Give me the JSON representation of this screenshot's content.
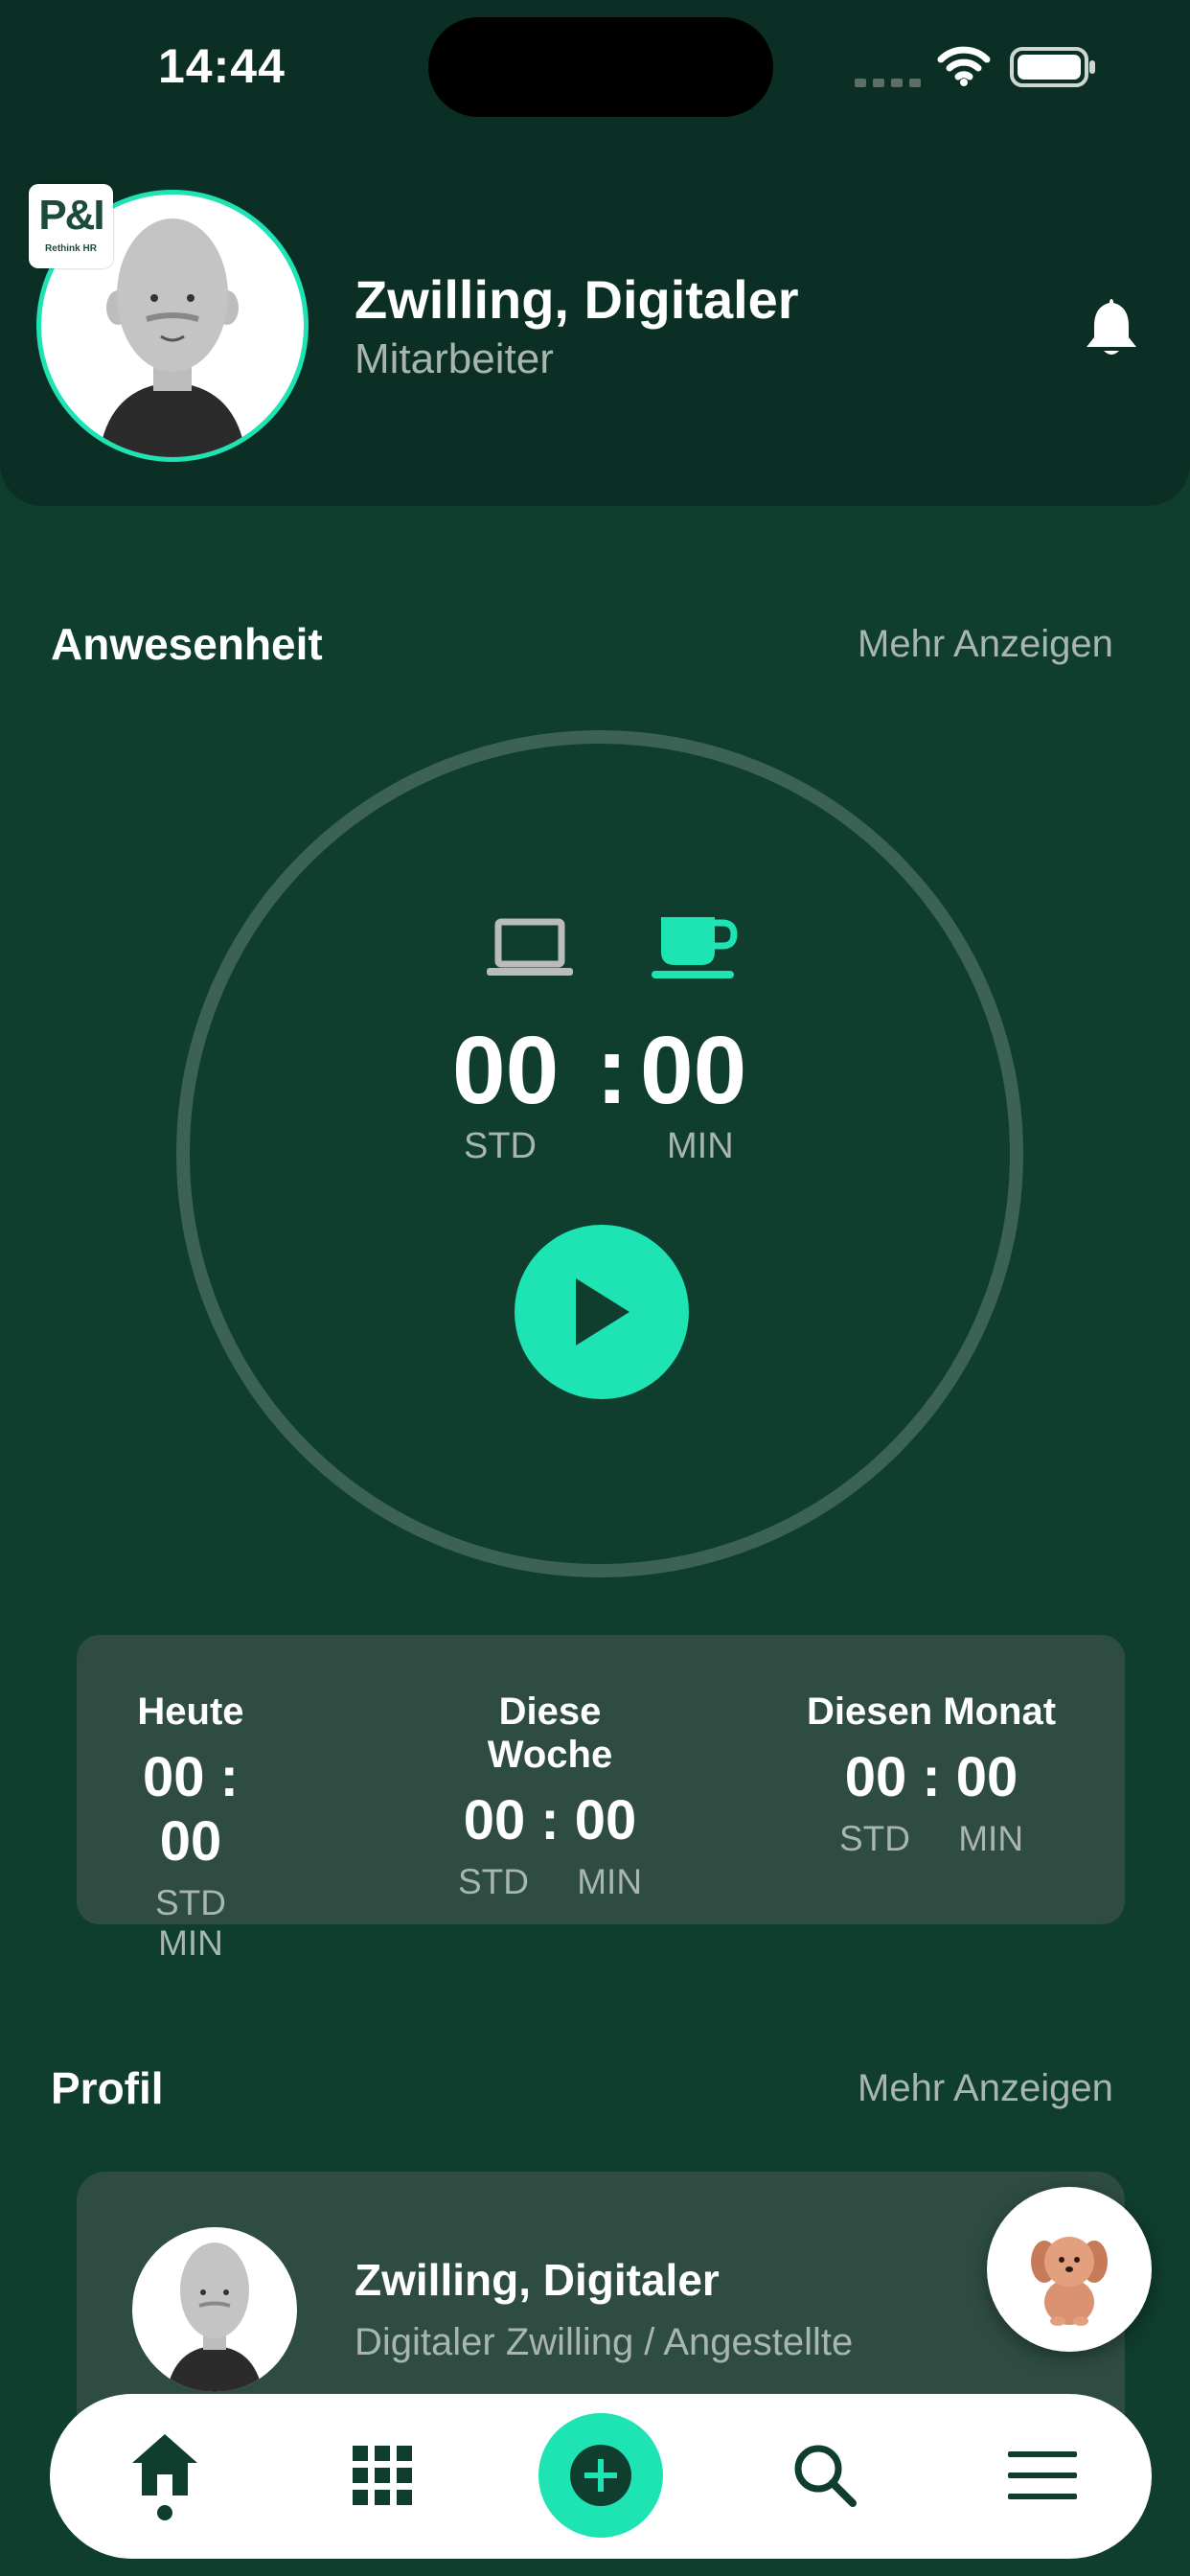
{
  "status_bar": {
    "time": "14:44"
  },
  "header": {
    "logo_text": "P&I",
    "logo_subtext": "Rethink HR",
    "user_name": "Zwilling, Digitaler",
    "user_role": "Mitarbeiter"
  },
  "attendance": {
    "title": "Anwesenheit",
    "more": "Mehr Anzeigen",
    "timer": {
      "hours": "00",
      "separator": ":",
      "minutes": "00",
      "hours_label": "STD",
      "minutes_label": "MIN"
    },
    "summary": [
      {
        "label": "Heute",
        "value": "00 : 00",
        "units": "STD MIN"
      },
      {
        "label": "Diese Woche",
        "value": "00 : 00",
        "units": "STD MIN"
      },
      {
        "label": "Diesen Monat",
        "value": "00 : 00",
        "units": "STD MIN"
      }
    ]
  },
  "profile": {
    "title": "Profil",
    "more": "Mehr Anzeigen",
    "name": "Zwilling, Digitaler",
    "description": "Digitaler Zwilling / Angestellte"
  },
  "icons": {
    "work_mode": "laptop-icon",
    "break_mode": "coffee-cup-icon",
    "nav": [
      "home-icon",
      "grid-icon",
      "plus-icon",
      "search-icon",
      "menu-icon"
    ]
  },
  "colors": {
    "background": "#0f3d2e",
    "header": "#0b2f24",
    "accent": "#1ee3b3",
    "card": "#2e4c42",
    "muted_text": "#a8b5b0"
  }
}
